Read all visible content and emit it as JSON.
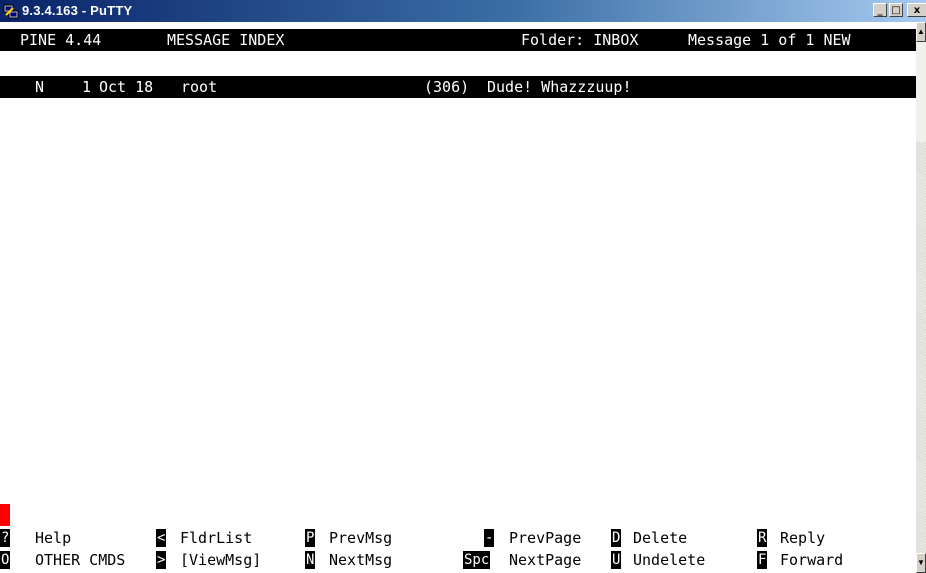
{
  "window": {
    "title": "9.3.4.163 - PuTTY",
    "buttons": {
      "minimize": "_",
      "maximize": "□",
      "close": "x"
    }
  },
  "header": {
    "app": "PINE 4.44",
    "screen": "MESSAGE INDEX",
    "folder": "Folder: INBOX",
    "message_status": "Message 1 of 1 NEW"
  },
  "messages": [
    {
      "flag": "N",
      "number": "1",
      "date": "Oct 18",
      "from": "root",
      "size": "(306)",
      "subject": "Dude! Whazzzuup!"
    }
  ],
  "commands": {
    "row1": [
      {
        "key": "?",
        "label": "Help"
      },
      {
        "key": "<",
        "label": "FldrList"
      },
      {
        "key": "P",
        "label": "PrevMsg"
      },
      {
        "key": "-",
        "label": "PrevPage"
      },
      {
        "key": "D",
        "label": "Delete"
      },
      {
        "key": "R",
        "label": "Reply"
      }
    ],
    "row2": [
      {
        "key": "O",
        "label": "OTHER CMDS"
      },
      {
        "key": ">",
        "label": "[ViewMsg]"
      },
      {
        "key": "N",
        "label": "NextMsg"
      },
      {
        "key": "Spc",
        "label": "NextPage"
      },
      {
        "key": "U",
        "label": "Undelete"
      },
      {
        "key": "F",
        "label": "Forward"
      }
    ]
  },
  "colors": {
    "titlebar_start": "#0a246a",
    "titlebar_end": "#a6caf0",
    "cursor": "#ff0000"
  }
}
